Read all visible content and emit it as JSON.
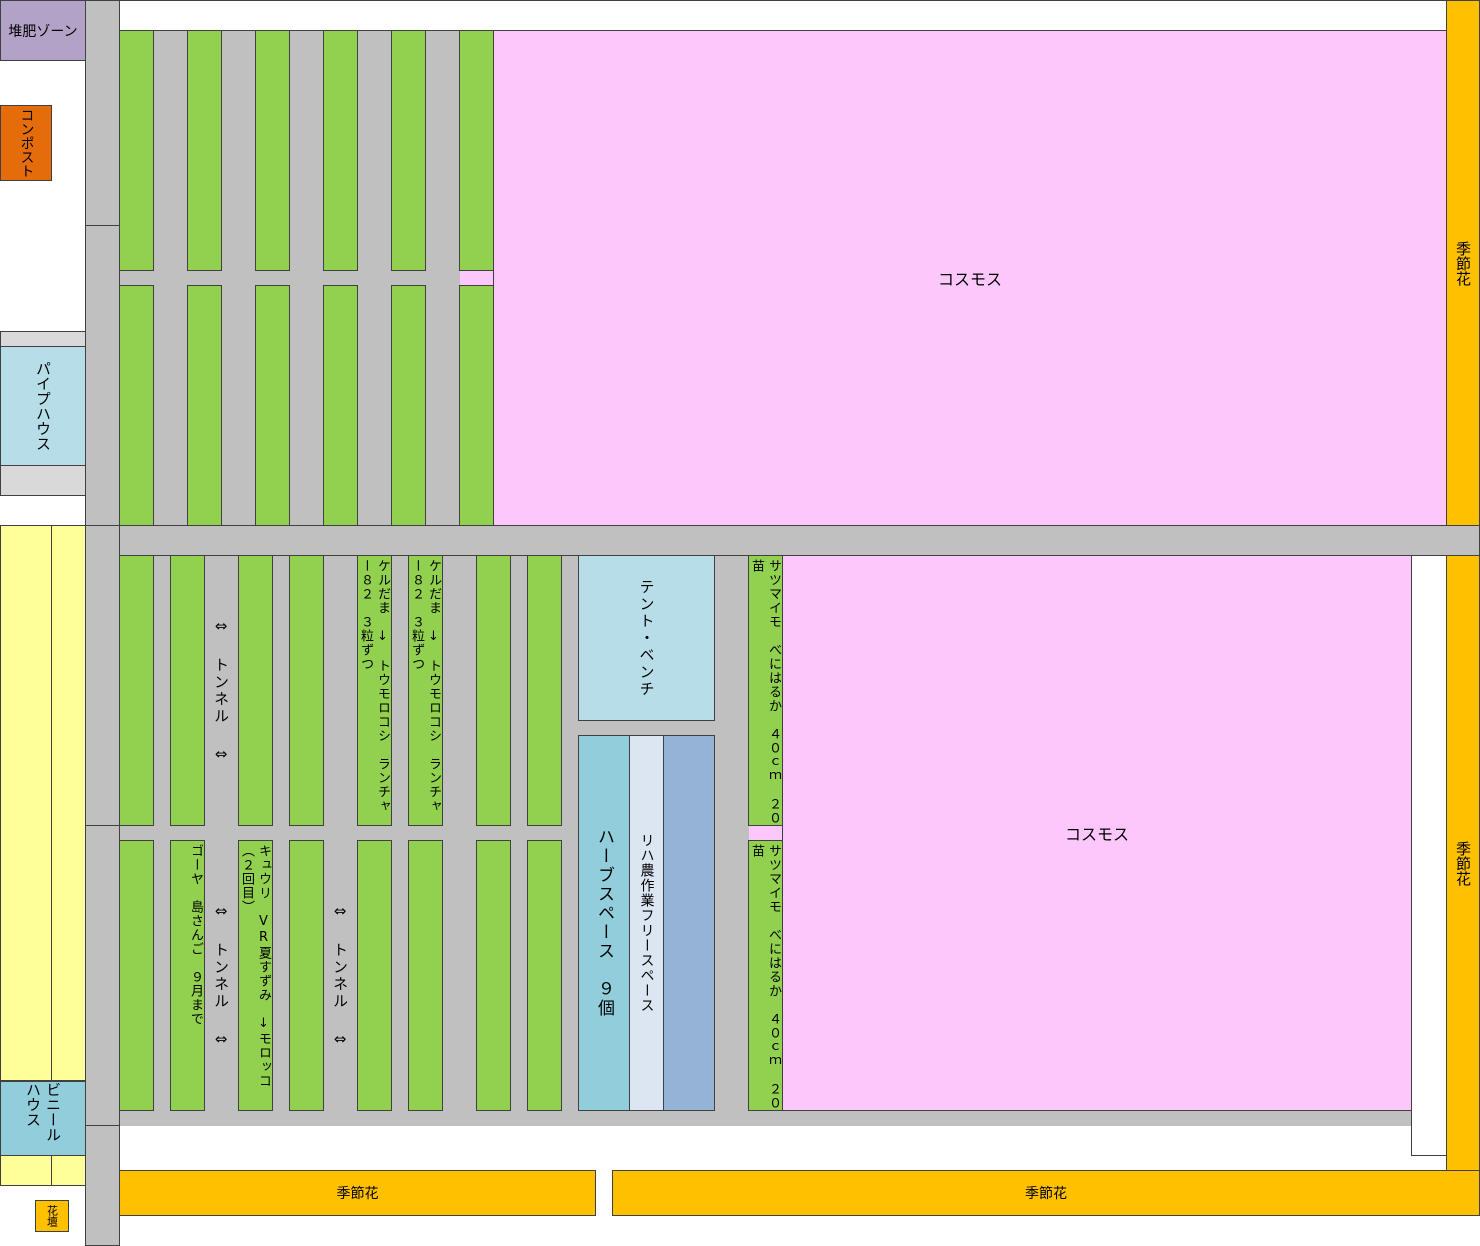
{
  "labels": {
    "compost_zone": "堆肥ゾーン",
    "compost": "コンポスト",
    "pipe_house": "パイプハウス",
    "vinyl_house": "ビニールハウス",
    "flower_bed": "花壇",
    "cosmos": "コスモス",
    "seasonal_flowers": "季節花",
    "tunnel": "⇔ トンネル ⇔",
    "tent_bench": "テント・ベンチ",
    "herb_space": "ハーブスペース　９個",
    "rehab_free_space": "リハ農作業フリースペース",
    "sweet_potato": "サツマイモ　べにはるか　４０ｃｍ　２０苗",
    "kerudama_corn": "ケルだま　↓　トウモロコシ　ランチャー８２　３粒ずつ",
    "goya": "ゴーヤ　島さんご　９月まで",
    "cucumber": "キュウリ　VR夏すずみ　↓モロッコ（２回目）"
  },
  "colors": {
    "path": "#c0c0c0",
    "bed": "#92d050",
    "cosmos": "#fcc8fc",
    "seasonal": "#ffc000",
    "house": "#b7dee8",
    "compost_zone": "#b3a2c7",
    "compost": "#e46c0a",
    "vinyl_area": "#ffff99",
    "herb": "#92cddc",
    "free_space": "#dce6f2",
    "blue_bed": "#95b3d7"
  }
}
